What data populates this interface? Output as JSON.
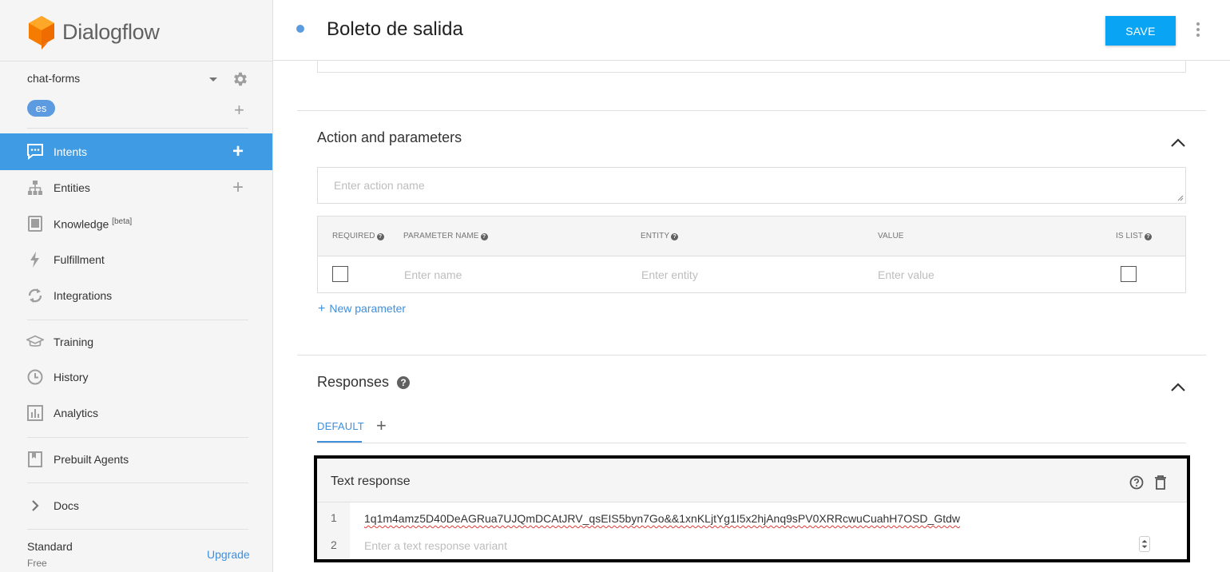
{
  "brand": {
    "name": "Dialogflow",
    "accent": "#3f9be3",
    "logo_color": "#f57c00"
  },
  "agent": {
    "name": "chat-forms",
    "language": "es"
  },
  "nav": [
    {
      "label": "Intents",
      "icon": "chat-bubble-icon",
      "active": true,
      "has_add": true
    },
    {
      "label": "Entities",
      "icon": "hierarchy-icon",
      "has_add": true
    },
    {
      "label": "Knowledge",
      "badge": "[beta]",
      "icon": "book-icon"
    },
    {
      "label": "Fulfillment",
      "icon": "bolt-icon"
    },
    {
      "label": "Integrations",
      "icon": "sync-icon"
    },
    {
      "label": "Training",
      "icon": "graduation-cap-icon"
    },
    {
      "label": "History",
      "icon": "clock-icon"
    },
    {
      "label": "Analytics",
      "icon": "bar-chart-icon"
    },
    {
      "label": "Prebuilt Agents",
      "icon": "bookmark-book-icon"
    },
    {
      "label": "Docs",
      "icon": "chevron-right-icon"
    }
  ],
  "plan": {
    "name": "Standard",
    "tier": "Free",
    "upgrade_label": "Upgrade"
  },
  "header": {
    "intent_name": "Boleto de salida",
    "save_label": "SAVE"
  },
  "action_section": {
    "title": "Action and parameters",
    "action_placeholder": "Enter action name",
    "columns": [
      "REQUIRED",
      "PARAMETER NAME",
      "ENTITY",
      "VALUE",
      "IS LIST"
    ],
    "row": {
      "name_placeholder": "Enter name",
      "entity_placeholder": "Enter entity",
      "value_placeholder": "Enter value"
    },
    "new_parameter_label": "New parameter"
  },
  "responses_section": {
    "title": "Responses",
    "tab_default": "DEFAULT",
    "text_response": {
      "title": "Text response",
      "lines": [
        {
          "num": "1",
          "text": "1q1m4amz5D40DeAGRua7UJQmDCAtJRV_qsEIS5byn7Go&&1xnKLjtYg1I5x2hjAnq9sPV0XRRcwuCuahH7OSD_Gtdw"
        },
        {
          "num": "2",
          "placeholder": "Enter a text response variant"
        }
      ]
    }
  }
}
